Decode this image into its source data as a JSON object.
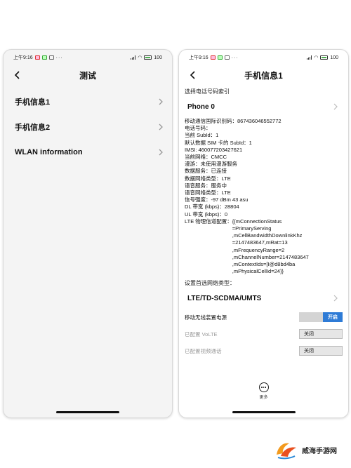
{
  "status_bar": {
    "time": "上午9:16",
    "battery": "100"
  },
  "left_screen": {
    "title": "测试",
    "items": [
      {
        "label": "手机信息1"
      },
      {
        "label": "手机信息2"
      },
      {
        "label": "WLAN information"
      }
    ]
  },
  "right_screen": {
    "title": "手机信息1",
    "phone_index_label": "选择电话号码索引",
    "phone_selector_value": "Phone 0",
    "info_lines": [
      "移动通信国际识别码：867436046552772",
      "电话号码：",
      "当前 SubId：1",
      "默认数据 SIM 卡的 SubId：1",
      "IMSI: 460077203427621",
      "当前网络：CMCC",
      "漫游：未使用漫游服务",
      "数据服务：已连接",
      "数据网络类型：LTE",
      "语音服务：服务中",
      "语音网络类型：LTE",
      "信号强度：-97 dBm   43 asu",
      "DL 带宽 (kbps)：28804",
      "UL 带宽 (kbps)：0"
    ],
    "lte_config_label": "LTE 物理信道配置：",
    "lte_config_values": [
      "{{mConnectionStatus",
      "=PrimaryServing",
      ",mCellBandwidthDownlinkKhz",
      "=2147483647,mRat=13",
      ",mFrequencyRange=2",
      ",mChannelNumber=2147483647",
      ",mContextIds=[I@d8bd4ba",
      ",mPhysicalCellId=24}}"
    ],
    "preferred_network_label": "设置首选网络类型：",
    "preferred_network_value": "LTE/TD-SCDMA/UMTS",
    "toggles": [
      {
        "label": "移动无线装置电源",
        "state": "开启",
        "on": true
      },
      {
        "label": "已配置 VoLTE",
        "state": "关闭",
        "on": false
      },
      {
        "label": "已配置视频通话",
        "state": "关闭",
        "on": false
      }
    ],
    "more_label": "更多"
  },
  "watermark": {
    "text": "威海手游网"
  },
  "colors": {
    "accent": "#2e7bd6",
    "screen_bg": "#f4f4f4"
  }
}
